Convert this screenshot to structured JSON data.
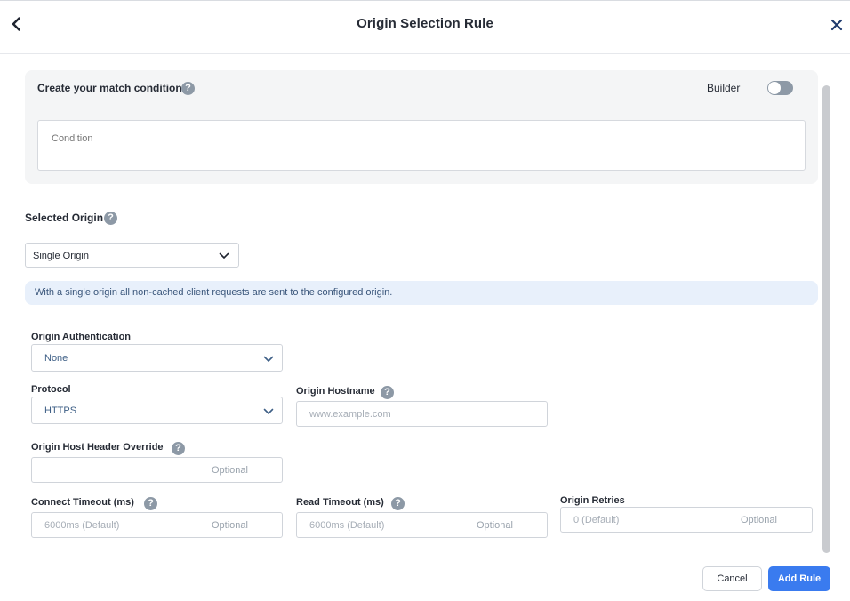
{
  "header": {
    "title": "Origin Selection Rule",
    "back_icon": "chevron-left-icon",
    "close_icon": "close-icon"
  },
  "match": {
    "label": "Create your match condition",
    "help": "?",
    "builder_label": "Builder",
    "builder_on": false,
    "condition_placeholder": "Condition"
  },
  "selected_origin": {
    "label": "Selected Origin",
    "help": "?",
    "value": "Single Origin",
    "info": "With a single origin all non-cached client requests are sent to the configured origin."
  },
  "form": {
    "auth": {
      "label": "Origin Authentication",
      "value": "None"
    },
    "protocol": {
      "label": "Protocol",
      "value": "HTTPS"
    },
    "hostname": {
      "label": "Origin Hostname",
      "help": "?",
      "placeholder": "www.example.com"
    },
    "host_header": {
      "label": "Origin Host Header Override",
      "help": "?",
      "optional": "Optional"
    },
    "connect_timeout": {
      "label": "Connect Timeout (ms)",
      "help": "?",
      "placeholder": "6000ms (Default)",
      "optional": "Optional"
    },
    "read_timeout": {
      "label": "Read Timeout (ms)",
      "help": "?",
      "placeholder": "6000ms (Default)",
      "optional": "Optional"
    },
    "retries": {
      "label": "Origin Retries",
      "placeholder": "0 (Default)",
      "optional": "Optional"
    }
  },
  "footer": {
    "cancel_label": "Cancel",
    "add_label": "Add Rule"
  },
  "colors": {
    "accent": "#3a7bef",
    "help_icon": "#8d99a6",
    "info_bg": "#e8f0fb"
  }
}
